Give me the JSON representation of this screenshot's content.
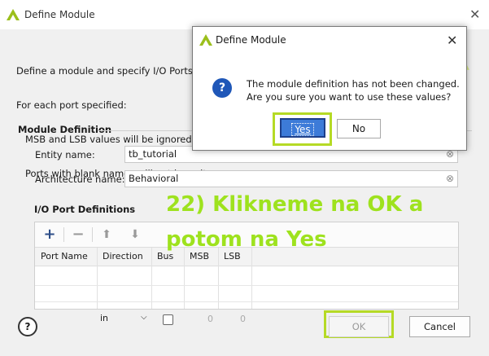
{
  "main": {
    "title": "Define Module",
    "intro_lines": [
      "Define a module and specify I/O Ports to",
      "For each port specified:",
      "   MSB and LSB values will be ignored u",
      "   Ports with blank names will not be writ"
    ],
    "section_label": "Module Definition",
    "entity_label": "Entity name:",
    "entity_value": "tb_tutorial",
    "arch_label": "Architecture name:",
    "arch_value": "Behavioral",
    "io_label": "I/O Port Definitions",
    "table": {
      "headers": [
        "Port Name",
        "Direction",
        "Bus",
        "MSB",
        "LSB"
      ],
      "row": {
        "direction": "in",
        "msb": "0",
        "lsb": "0"
      }
    },
    "ok_label": "OK",
    "cancel_label": "Cancel",
    "help_label": "?"
  },
  "annotation": {
    "line1": "22) Klikneme na OK a",
    "line2": "potom na Yes",
    "color": "#9ee21e"
  },
  "modal": {
    "title": "Define Module",
    "message_line1": "The module definition has not been changed.",
    "message_line2": "Are you sure you want to use these values?",
    "yes_label": "Yes",
    "no_label": "No",
    "icon": "question-icon"
  },
  "colors": {
    "accent": "#3d7bd8",
    "highlight": "#b5da25"
  }
}
